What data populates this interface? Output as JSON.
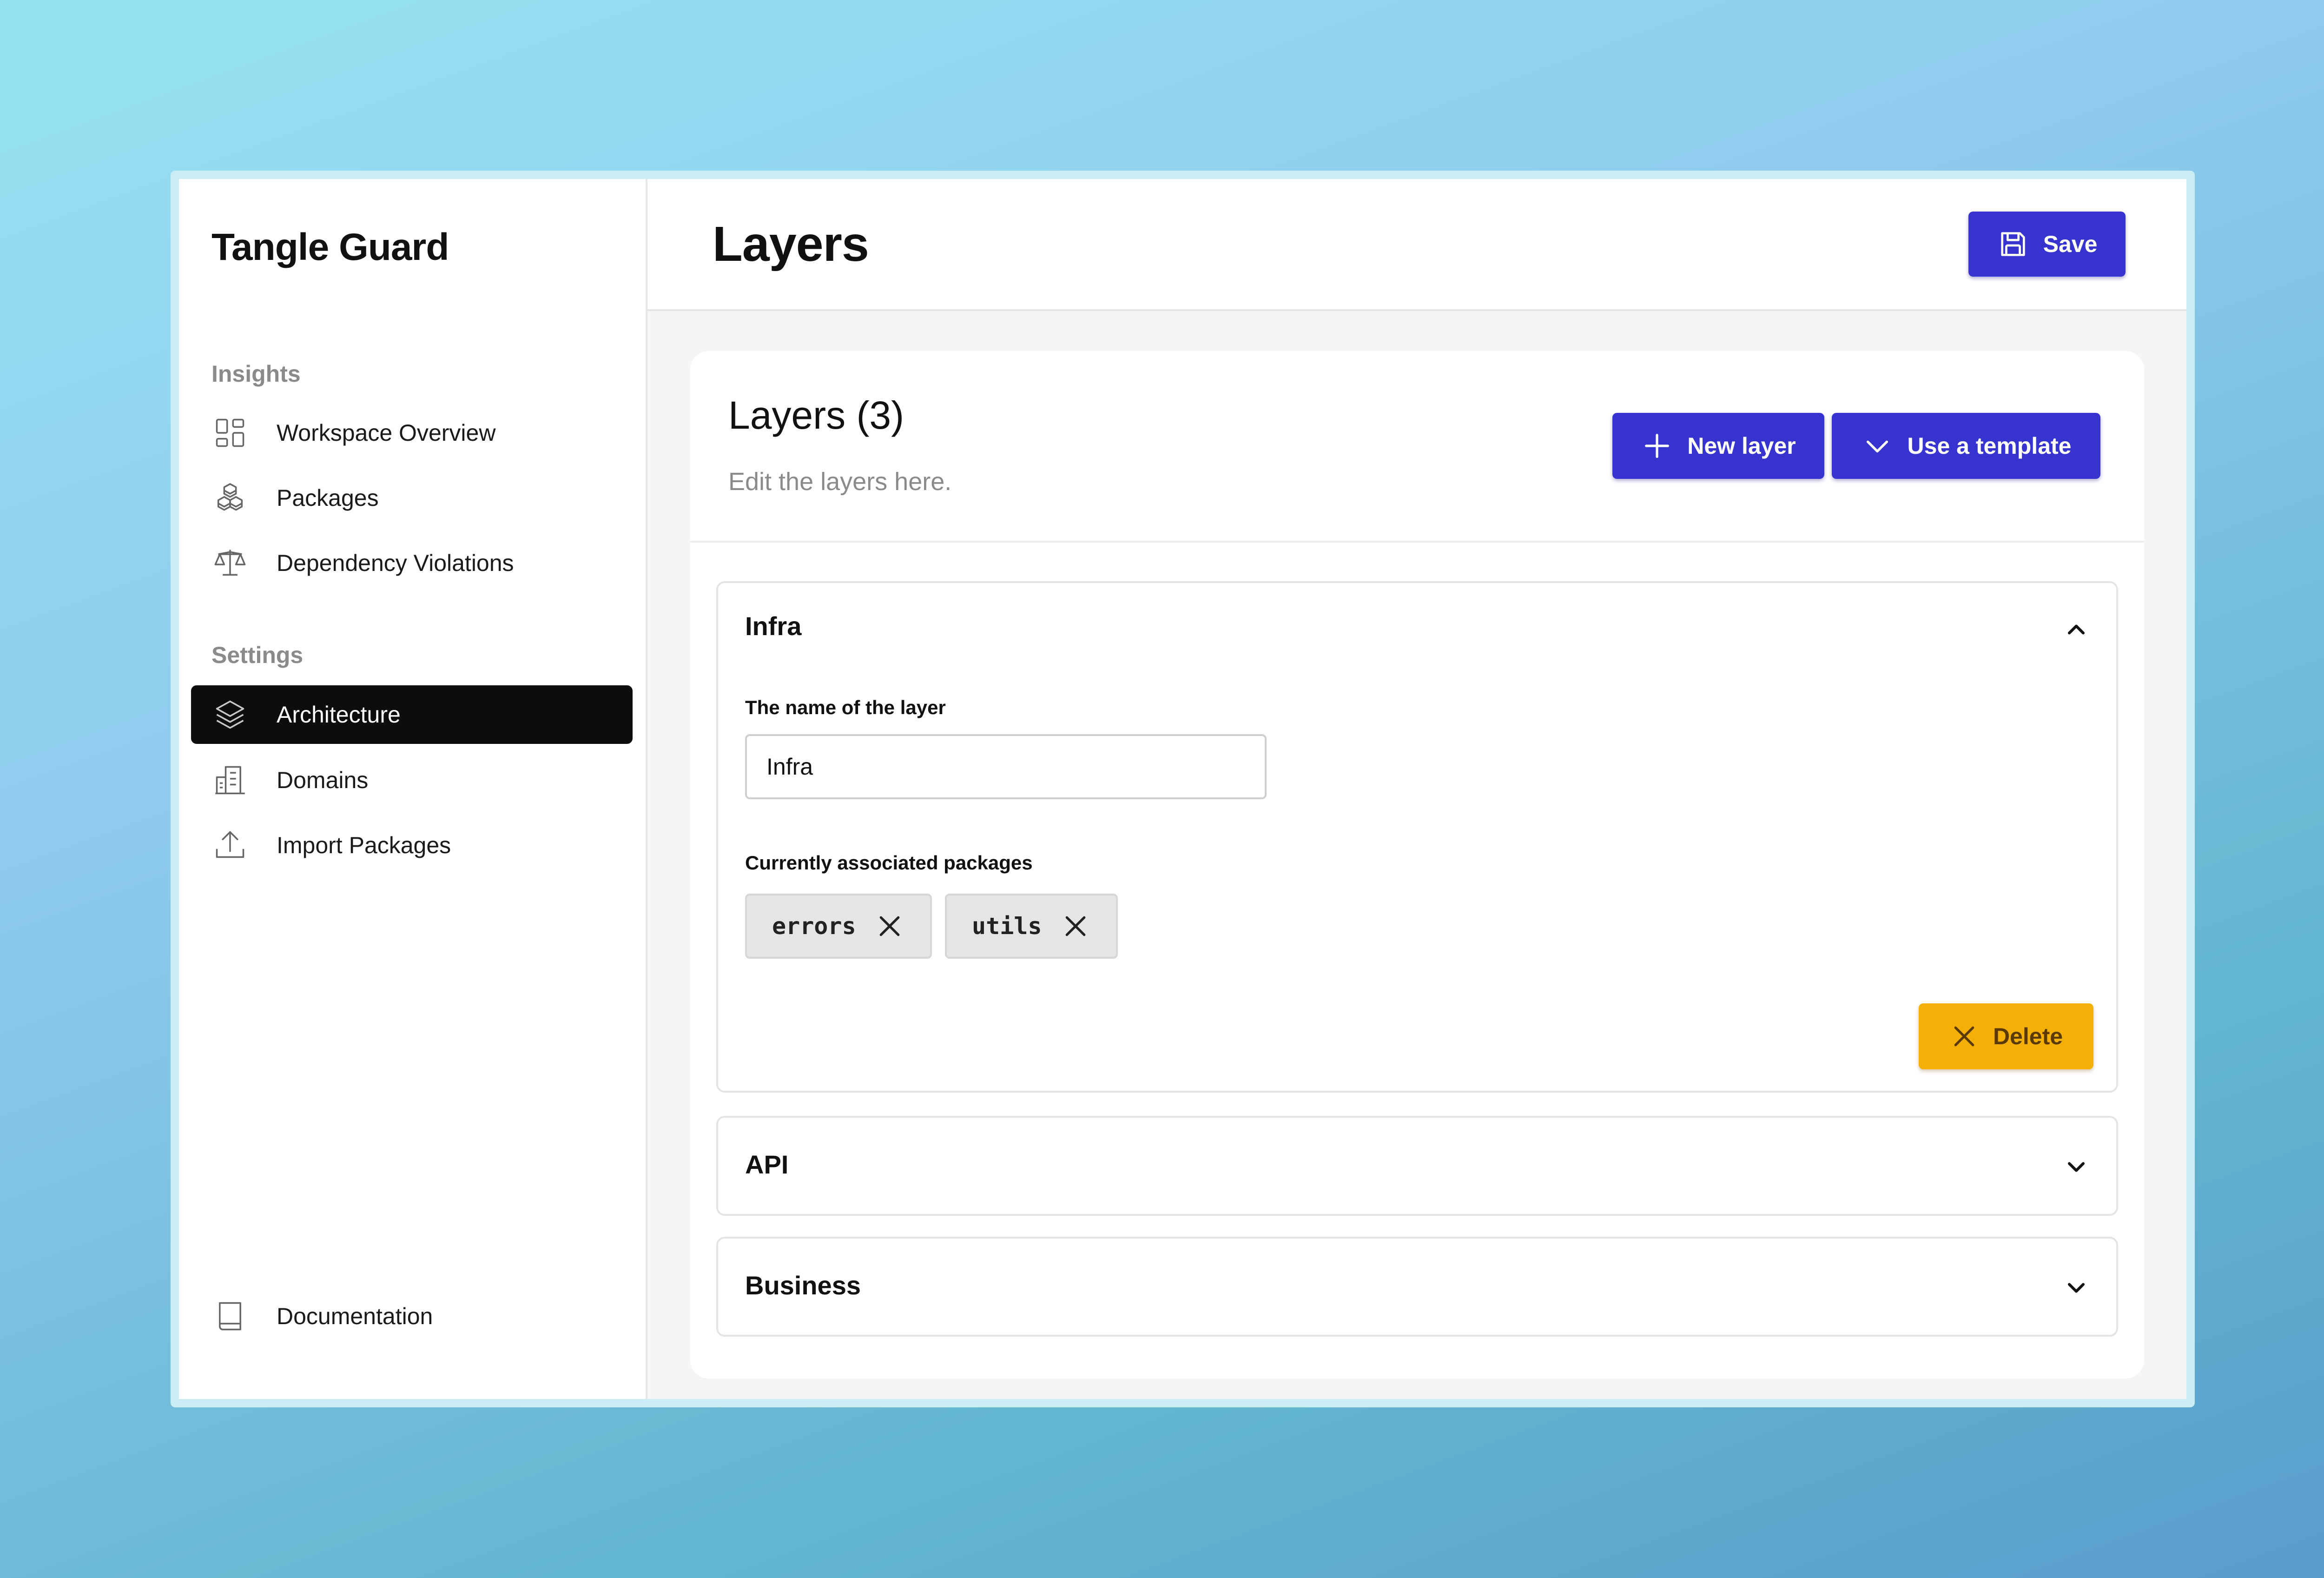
{
  "app": {
    "name": "Tangle Guard"
  },
  "sidebar": {
    "sections": [
      {
        "label": "Insights"
      },
      {
        "label": "Settings"
      }
    ],
    "items": [
      {
        "label": "Workspace Overview",
        "icon": "dashboard-grid-icon"
      },
      {
        "label": "Packages",
        "icon": "cubes-icon"
      },
      {
        "label": "Dependency Violations",
        "icon": "scale-icon"
      },
      {
        "label": "Architecture",
        "icon": "layers-icon",
        "active": true
      },
      {
        "label": "Domains",
        "icon": "building-icon"
      },
      {
        "label": "Import Packages",
        "icon": "upload-icon"
      }
    ],
    "footer": {
      "label": "Documentation",
      "icon": "book-icon"
    }
  },
  "header": {
    "title": "Layers",
    "save_label": "Save"
  },
  "card": {
    "title": "Layers (3)",
    "subtitle": "Edit the layers here.",
    "new_layer_label": "New layer",
    "template_label": "Use a template"
  },
  "layers": [
    {
      "name": "Infra",
      "expanded": true,
      "name_label": "The name of the layer",
      "name_value": "Infra",
      "packages_label": "Currently associated packages",
      "packages": [
        "errors",
        "utils"
      ],
      "delete_label": "Delete"
    },
    {
      "name": "API",
      "expanded": false
    },
    {
      "name": "Business",
      "expanded": false
    }
  ],
  "colors": {
    "primary": "#3733cf",
    "warning": "#f4b007",
    "active_nav": "#0d0d0e"
  }
}
